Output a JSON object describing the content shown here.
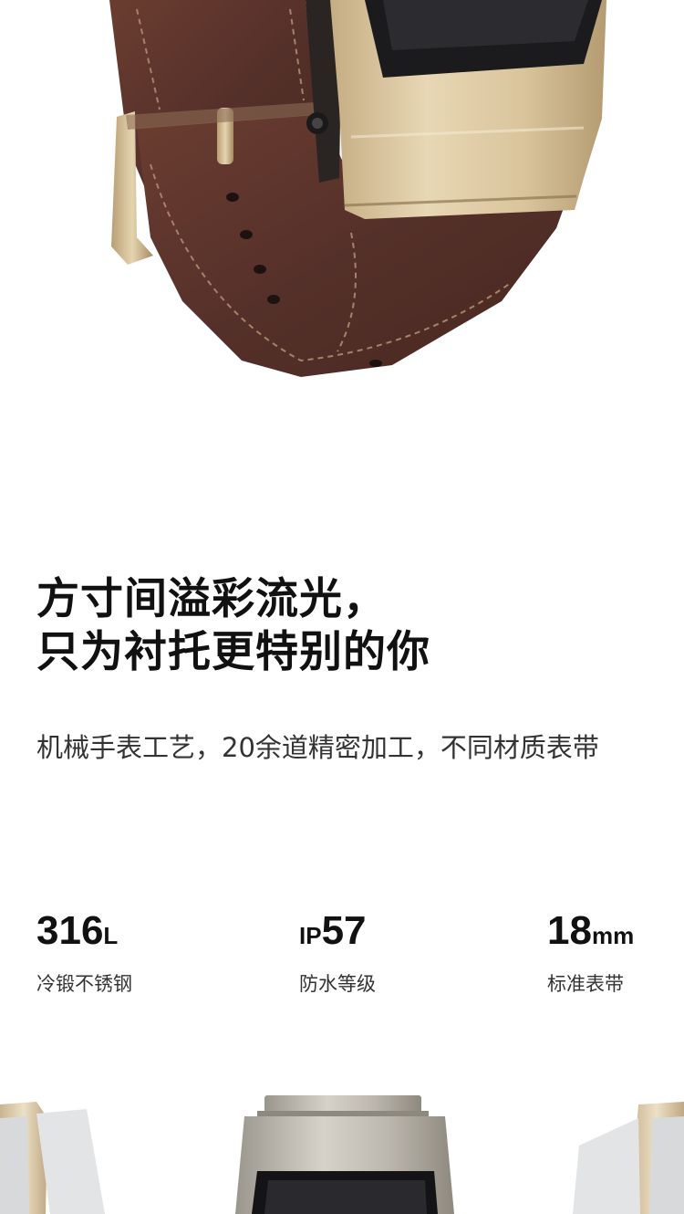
{
  "headline": {
    "line1": "方寸间溢彩流光，",
    "line2": "只为衬托更特别的你"
  },
  "subtitle": "机械手表工艺，20余道精密加工，不同材质表带",
  "specs": [
    {
      "prefix": "",
      "value": "316",
      "suffix": "L",
      "label": "冷锻不锈钢"
    },
    {
      "prefix": "IP",
      "value": "57",
      "suffix": "",
      "label": "防水等级"
    },
    {
      "prefix": "",
      "value": "18",
      "suffix": "mm",
      "label": "标准表带"
    }
  ],
  "colors": {
    "background": "#ffffff",
    "leather_strap": "#5a3126",
    "gold_metal": "#d8c29b",
    "silver_metal": "#b9b4ab"
  },
  "images": {
    "hero": "watch-brown-leather-strap-gold-case",
    "bottom_variants": [
      "watch-white-leather-strap",
      "watch-silver-metal-link-strap",
      "watch-white-leather-strap"
    ]
  }
}
